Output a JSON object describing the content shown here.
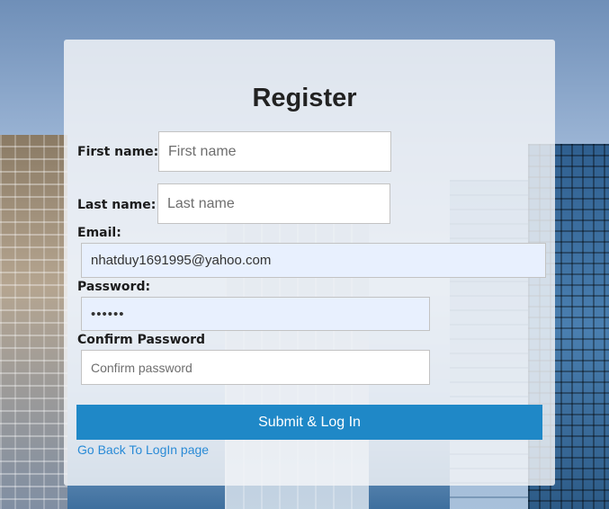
{
  "form": {
    "title": "Register",
    "first_name": {
      "label": "First name:",
      "placeholder": "First name",
      "value": ""
    },
    "last_name": {
      "label": "Last name:",
      "placeholder": "Last name",
      "value": ""
    },
    "email": {
      "label": "Email:",
      "value": "nhatduy1691995@yahoo.com"
    },
    "password": {
      "label": "Password:",
      "value": "••••••"
    },
    "confirm_password": {
      "label": "Confirm Password",
      "placeholder": "Confirm password",
      "value": ""
    },
    "submit_label": "Submit & Log In",
    "back_link": "Go Back To LogIn page"
  },
  "colors": {
    "accent": "#1f88c7",
    "link": "#2a8bd6",
    "autofill_bg": "#e8f0fe"
  }
}
